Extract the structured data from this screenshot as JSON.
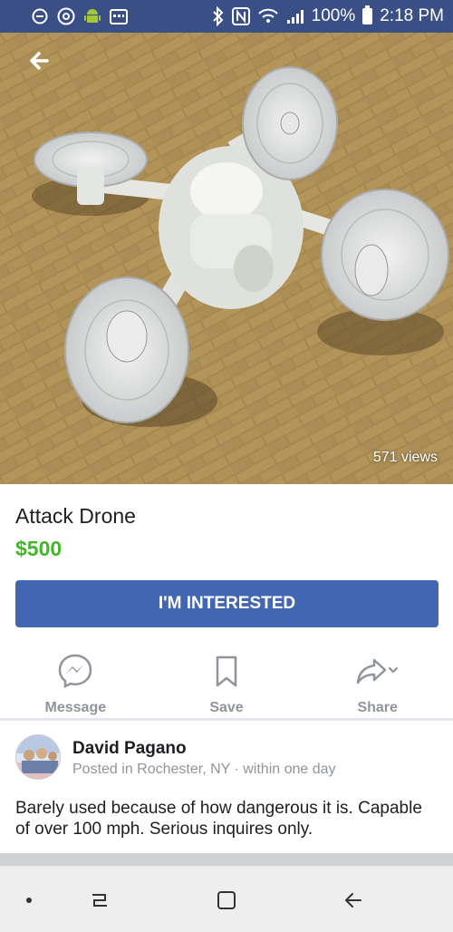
{
  "status_bar": {
    "battery": "100%",
    "time": "2:18 PM"
  },
  "photo": {
    "views": "571 views"
  },
  "listing": {
    "title": "Attack Drone",
    "price": "$500",
    "cta_label": "I'M INTERESTED"
  },
  "actions": {
    "message": "Message",
    "save": "Save",
    "share": "Share"
  },
  "seller": {
    "name": "David Pagano",
    "meta": "Posted in Rochester, NY · within one day"
  },
  "description": "Barely used because of how dangerous it is. Capable of over 100 mph. Serious inquires only.",
  "colors": {
    "status_bar": "#3a4f86",
    "primary_button": "#4267b2",
    "price": "#42b72a",
    "muted_text": "#90949c"
  }
}
